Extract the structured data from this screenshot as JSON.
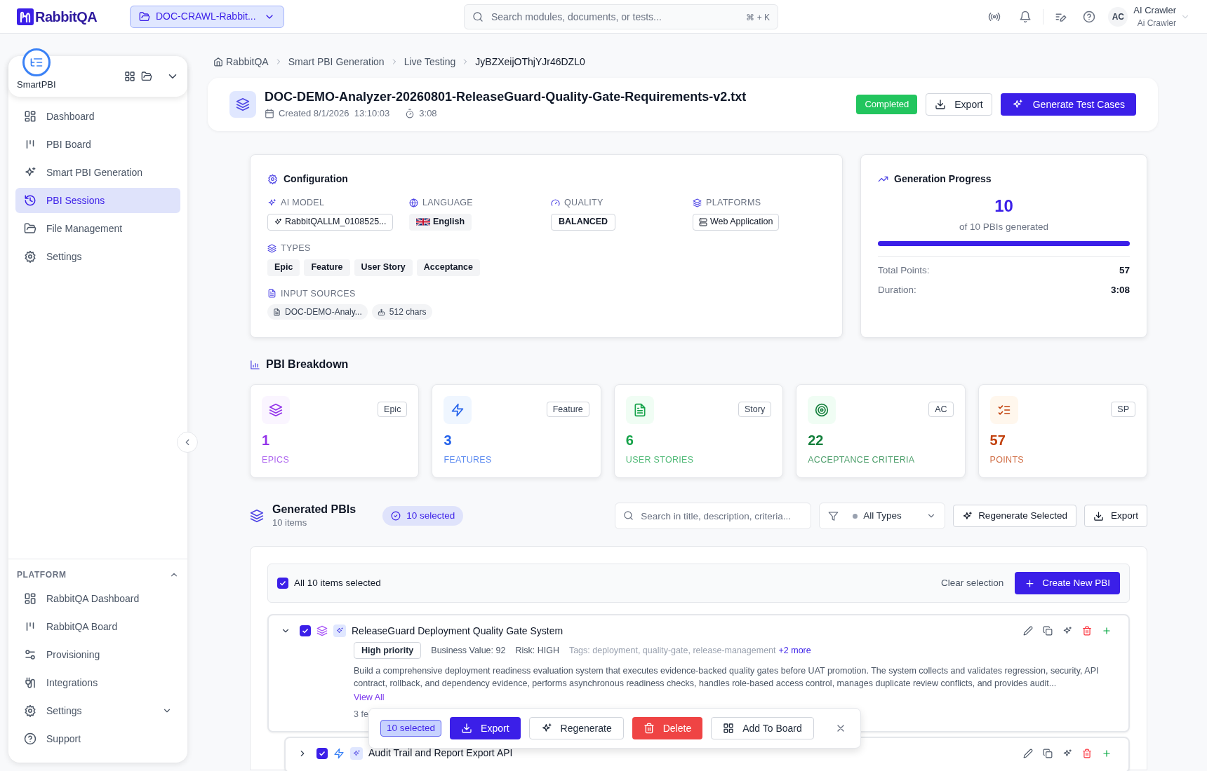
{
  "topbar": {
    "logo": "RabbitQA",
    "project": "DOC-CRAWL-Rabbit...",
    "search_placeholder": "Search modules, documents, or tests...",
    "shortcut": "⌘ + K",
    "user": {
      "initials": "AC",
      "name": "AI Crawler",
      "role": "Ai Crawler"
    }
  },
  "sidebar": {
    "module": "SmartPBI",
    "items": [
      {
        "label": "Dashboard",
        "selected": false
      },
      {
        "label": "PBI Board",
        "selected": false
      },
      {
        "label": "Smart PBI Generation",
        "selected": false
      },
      {
        "label": "PBI Sessions",
        "selected": true
      },
      {
        "label": "File Management",
        "selected": false
      },
      {
        "label": "Settings",
        "selected": false
      }
    ],
    "platform": {
      "title": "PLATFORM",
      "expanded": true,
      "items": [
        {
          "label": "RabbitQA Dashboard",
          "submenu": false
        },
        {
          "label": "RabbitQA Board",
          "submenu": false
        },
        {
          "label": "Provisioning",
          "submenu": false
        },
        {
          "label": "Integrations",
          "submenu": false
        },
        {
          "label": "Settings",
          "submenu": true
        },
        {
          "label": "Support",
          "submenu": false
        }
      ]
    }
  },
  "breadcrumb": [
    "RabbitQA",
    "Smart PBI Generation",
    "Live Testing",
    "JyBZXeijOThjYJr46DZL0"
  ],
  "session": {
    "title": "DOC-DEMO-Analyzer-20260801-ReleaseGuard-Quality-Gate-Requirements-v2.txt",
    "created": "Created 8/1/2026  13:10:03",
    "duration": "3:08",
    "status": "Completed",
    "export": "Export",
    "generate": "Generate Test Cases"
  },
  "configuration": {
    "title": "Configuration",
    "fields": [
      {
        "kind": "model",
        "label": "AI MODEL",
        "value": "RabbitQALLM_0108525..."
      },
      {
        "kind": "language",
        "label": "LANGUAGE",
        "value": "English"
      },
      {
        "kind": "quality",
        "label": "QUALITY",
        "value": "BALANCED"
      },
      {
        "kind": "platforms",
        "label": "PLATFORMS",
        "value": "Web Application"
      }
    ],
    "types": {
      "label": "TYPES",
      "values": [
        "Epic",
        "Feature",
        "User Story",
        "Acceptance"
      ]
    },
    "input_sources": {
      "label": "INPUT SOURCES",
      "values": [
        {
          "kind": "file",
          "text": "DOC-DEMO-Analy..."
        },
        {
          "kind": "chars",
          "text": "512 chars"
        }
      ]
    }
  },
  "progress": {
    "title": "Generation Progress",
    "count": "10",
    "caption": "of 10 PBIs generated",
    "level": 1,
    "stats": [
      {
        "label": "Total Points:",
        "value": "57"
      },
      {
        "label": "Duration:",
        "value": "3:08"
      }
    ]
  },
  "breakdown": {
    "title": "PBI Breakdown",
    "cards": [
      {
        "kind": "epic",
        "tag": "Epic",
        "count": "1",
        "label": "EPICS",
        "color": "#9333ea"
      },
      {
        "kind": "feature",
        "tag": "Feature",
        "count": "3",
        "label": "FEATURES",
        "color": "#2563eb"
      },
      {
        "kind": "story",
        "tag": "Story",
        "count": "6",
        "label": "USER STORIES",
        "color": "#16a34a"
      },
      {
        "kind": "criteria",
        "tag": "AC",
        "count": "22",
        "label": "ACCEPTANCE CRITERIA",
        "color": "#15803d"
      },
      {
        "kind": "points",
        "tag": "SP",
        "count": "57",
        "label": "POINTS",
        "color": "#c2410c"
      }
    ]
  },
  "pbis": {
    "title": "Generated PBIs",
    "count": "10 items",
    "selected_badge": "10 selected",
    "search_placeholder": "Search in title, description, criteria...",
    "filter": "All Types",
    "regenerate": "Regenerate Selected",
    "export": "Export",
    "selection_bar": {
      "checked": true,
      "text": "All 10 items selected",
      "clear": "Clear selection",
      "create": "Create New PBI"
    },
    "items": [
      {
        "kind": "epic",
        "checked": true,
        "expanded": true,
        "title": "ReleaseGuard Deployment Quality Gate System",
        "priority": "High priority",
        "business_value": "Business Value: 92",
        "risk": "Risk: HIGH",
        "tags": "Tags: deployment, quality-gate, release-management",
        "more": "+2 more",
        "description": "Build a comprehensive deployment readiness evaluation system that executes evidence-backed quality gates before UAT promotion. The system collects and validates regression, security, API contract, rollback, and dependency evidence, performs asynchronous readiness checks, handles role-based access control, manages duplicate review conflicts, and provides audit...",
        "view_all": "View All",
        "footer": "3 fe",
        "children": [
          {
            "kind": "feature",
            "checked": true,
            "expanded": false,
            "title": "Audit Trail and Report Export API"
          }
        ]
      }
    ]
  },
  "bulk_bar": {
    "count": "10 selected",
    "actions": [
      {
        "kind": "export",
        "label": "Export"
      },
      {
        "kind": "regenerate",
        "label": "Regenerate"
      },
      {
        "kind": "delete",
        "label": "Delete"
      },
      {
        "kind": "board",
        "label": "Add To Board"
      }
    ]
  }
}
